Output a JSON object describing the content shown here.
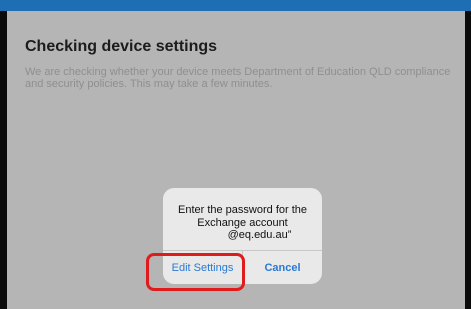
{
  "page": {
    "title": "Checking device settings",
    "description": "We are checking whether your device meets Department of Education QLD compliance and security policies. This may take a few minutes."
  },
  "dialog": {
    "message_line1": "Enter the password for the",
    "message_line2": "Exchange account",
    "message_line3": "@eq.edu.au”",
    "edit_settings_label": "Edit Settings",
    "cancel_label": "Cancel"
  },
  "colors": {
    "accent": "#2a7ad4",
    "highlight": "#e01b1b",
    "top_bar": "#1e6eb4"
  }
}
